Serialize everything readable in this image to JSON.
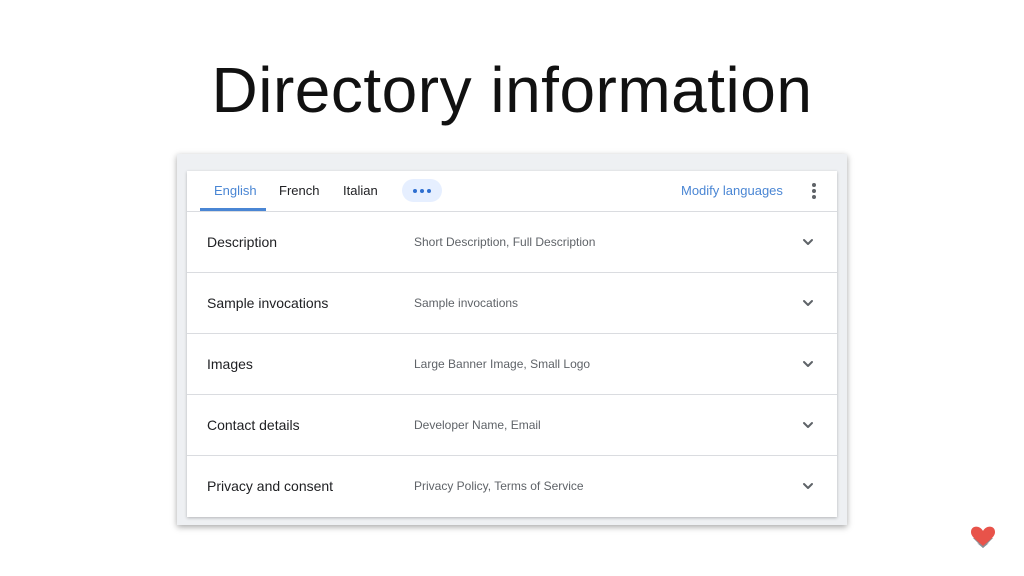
{
  "slide": {
    "title": "Directory information"
  },
  "tabs": {
    "items": [
      {
        "label": "English",
        "active": true
      },
      {
        "label": "French",
        "active": false
      },
      {
        "label": "Italian",
        "active": false
      }
    ],
    "more_icon": "more-horiz-icon",
    "modify_label": "Modify languages",
    "menu_icon": "more-vert-icon"
  },
  "sections": [
    {
      "title": "Description",
      "summary": "Short Description, Full Description"
    },
    {
      "title": "Sample invocations",
      "summary": "Sample invocations"
    },
    {
      "title": "Images",
      "summary": "Large Banner Image, Small Logo"
    },
    {
      "title": "Contact details",
      "summary": "Developer Name, Email"
    },
    {
      "title": "Privacy and consent",
      "summary": "Privacy Policy, Terms of Service"
    }
  ],
  "colors": {
    "accent": "#4a86d4",
    "pill_bg": "#e6efff",
    "divider": "#dadce0",
    "logo_red": "#e8534a",
    "logo_gray": "#8a8f96"
  }
}
